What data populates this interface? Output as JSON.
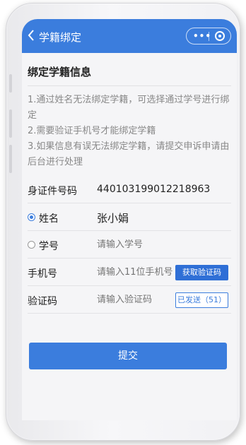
{
  "header": {
    "back_icon": "chevron-left-icon",
    "title": "学籍绑定",
    "menu_icon": "more-dots-icon",
    "close_icon": "target-icon"
  },
  "info": {
    "title": "绑定学籍信息",
    "notes": [
      "1.通过姓名无法绑定学籍，可选择通过学号进行绑定",
      "2.需要验证手机号才能绑定学籍",
      "3.如果信息有误无法绑定学籍，请提交申诉申请由后台进行处理"
    ]
  },
  "form": {
    "id_label": "身证件号码",
    "id_value": "440103199012218963",
    "name_label": "姓名",
    "name_value": "张小娟",
    "name_selected": true,
    "student_no_label": "学号",
    "student_no_placeholder": "请输入学号",
    "student_no_selected": false,
    "phone_label": "手机号",
    "phone_placeholder": "请输入11位手机号",
    "get_code_label": "获取验证码",
    "code_label": "验证码",
    "code_placeholder": "请输入验证码",
    "sent_label": "已发送（51）"
  },
  "submit_label": "提交",
  "colors": {
    "primary": "#3b7ddd",
    "background": "#f5f5f7"
  }
}
